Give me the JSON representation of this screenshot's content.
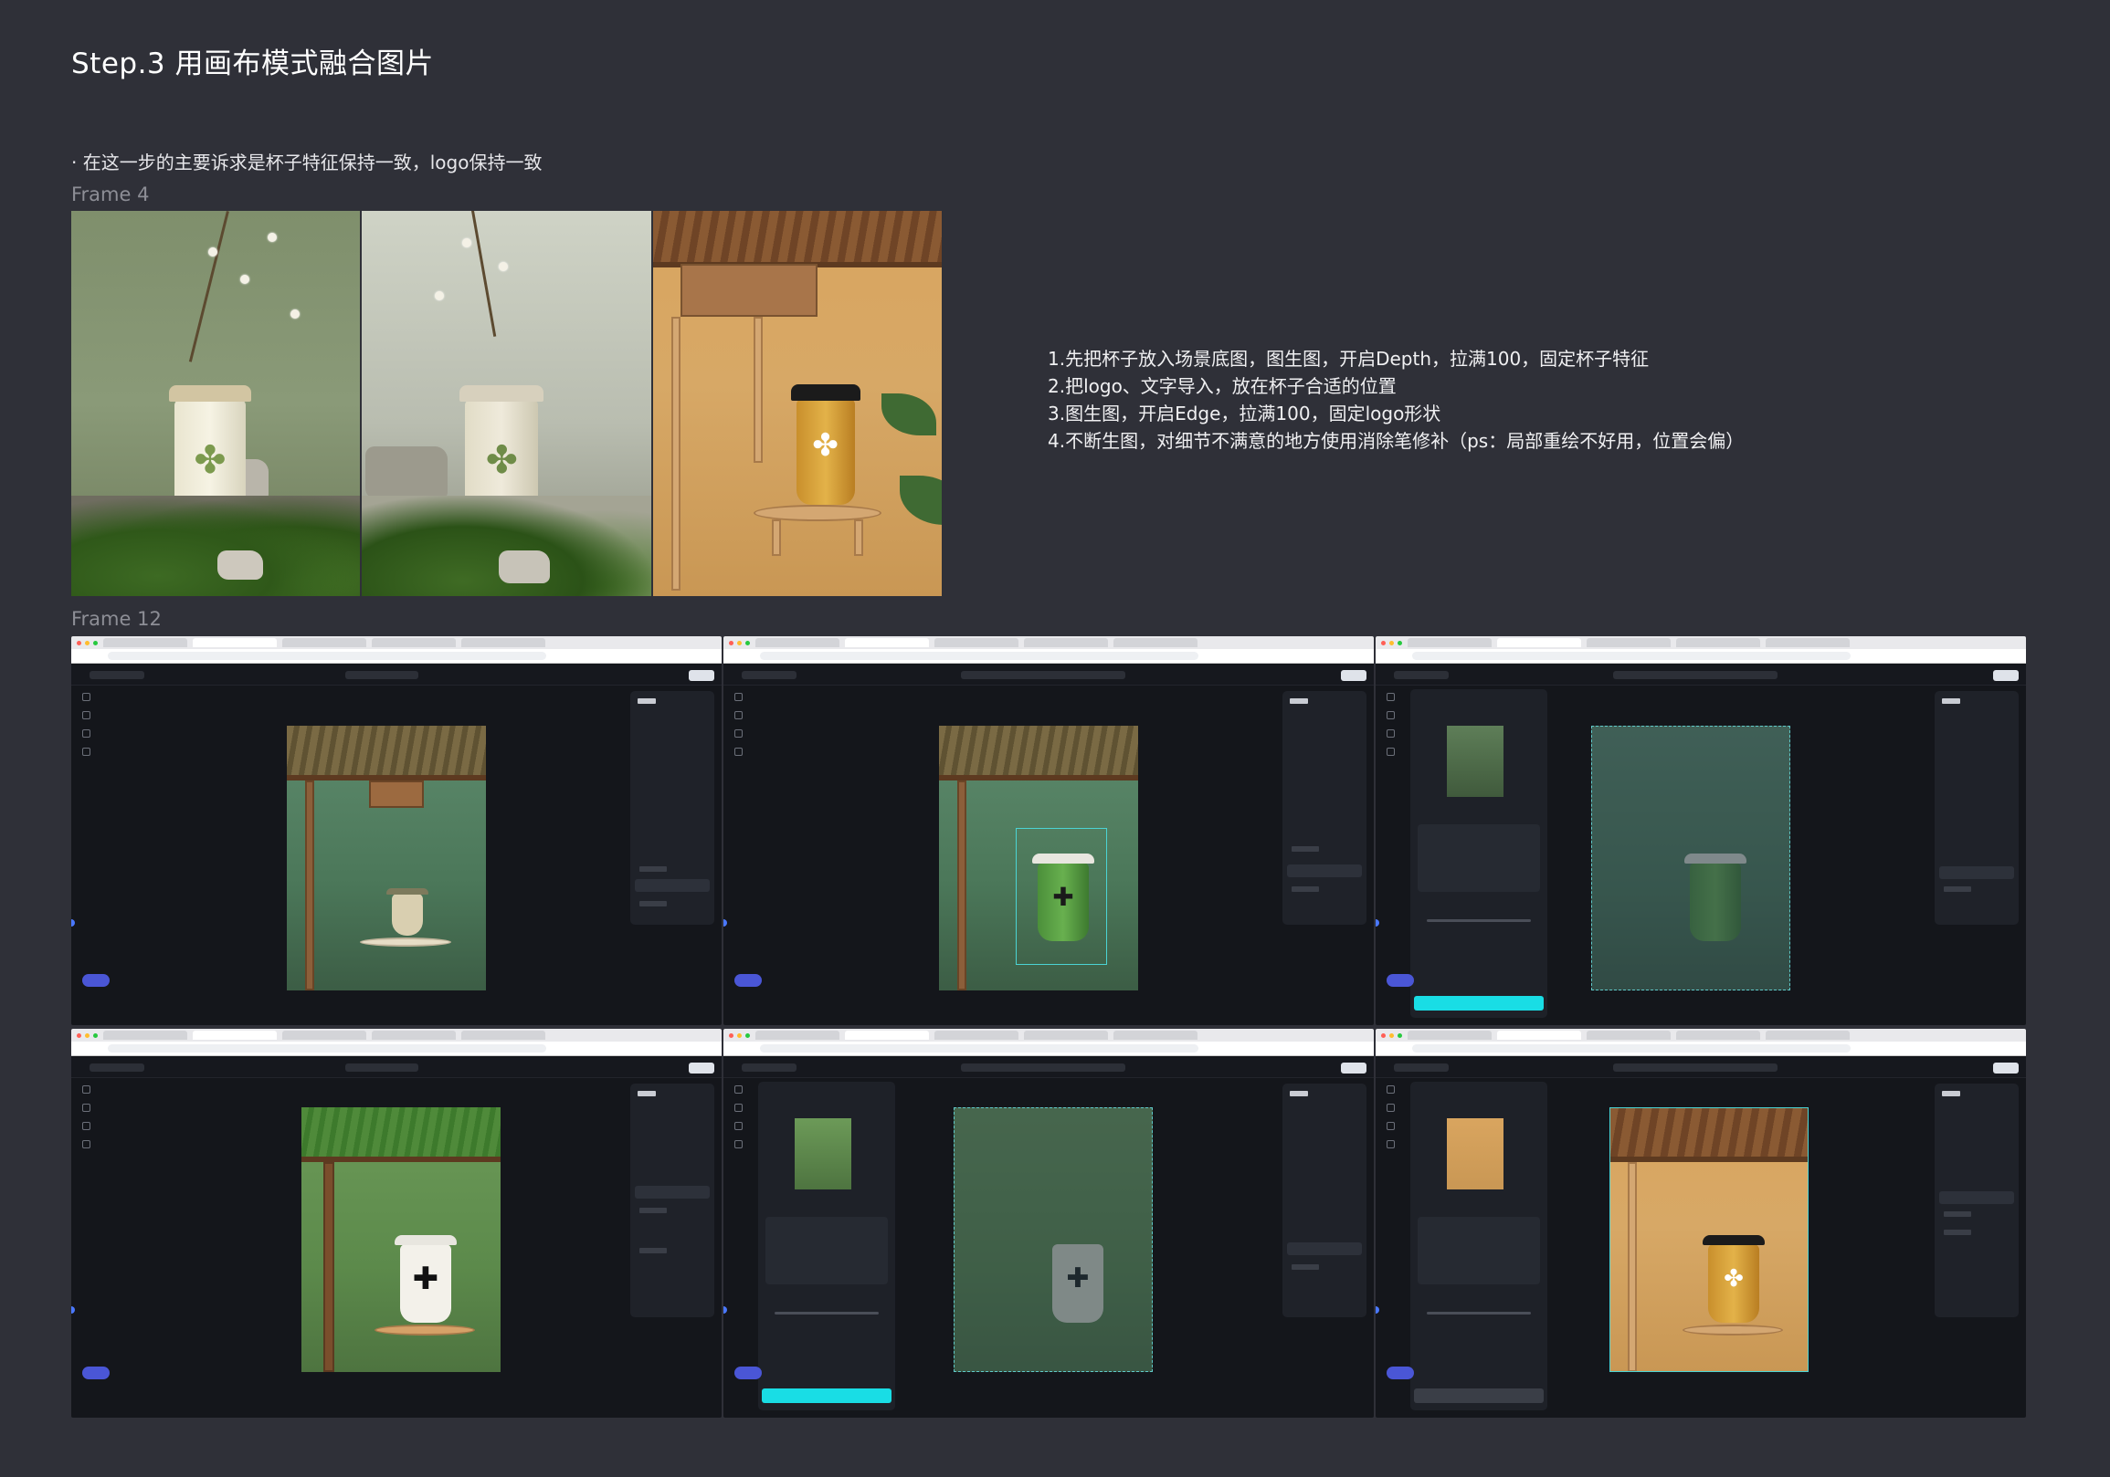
{
  "page": {
    "title": "Step.3 用画布模式融合图片",
    "subtitle": "· 在这一步的主要诉求是杯子特征保持一致，logo保持一致",
    "frame4_label": "Frame 4",
    "frame12_label": "Frame 12"
  },
  "steps": [
    "1.先把杯子放入场景底图，图生图，开启Depth，拉满100，固定杯子特征",
    "2.把logo、文字导入，放在杯子合适的位置",
    "3.图生图，开启Edge，拉满100，固定logo形状",
    "4.不断生图，对细节不满意的地方使用消除笔修补（ps：局部重绘不好用，位置会偏）"
  ],
  "colors": {
    "background": "#2f3038",
    "cta": "#19dde5",
    "fab": "#4a56d6",
    "selection": "#4bd4d4"
  },
  "icons": [
    "tool-icon",
    "lid-icon",
    "flower-logo-icon"
  ]
}
